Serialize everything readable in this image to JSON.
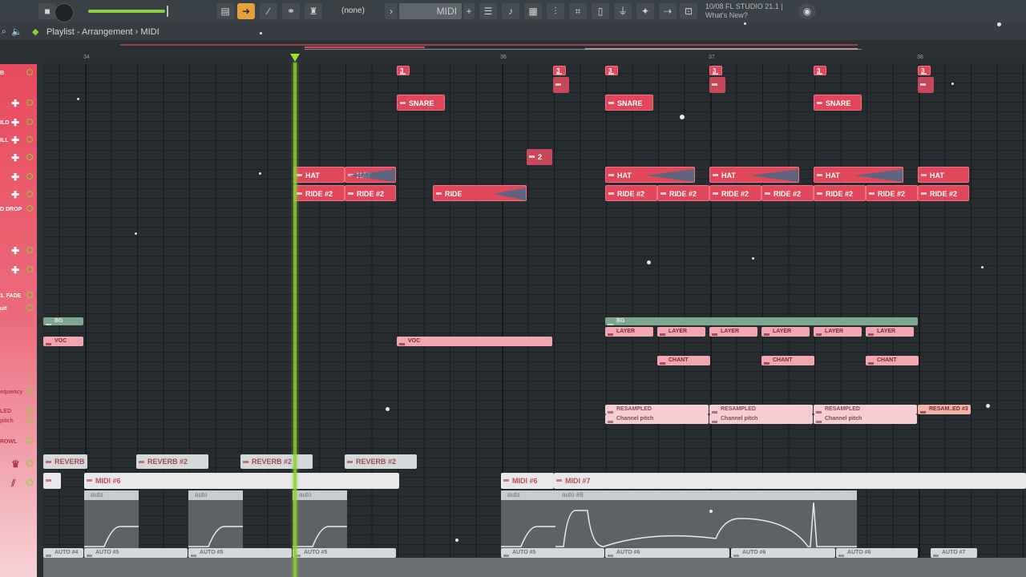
{
  "app": {
    "toolbar": {
      "pattern_selector": "(none)",
      "midi_field": "MIDI",
      "version_line1": "10/08  FL STUDIO 21.1 |",
      "version_line2": "What's New?"
    },
    "playlist": {
      "title": "Playlist - Arrangement",
      "breadcrumb_sep": "›",
      "breadcrumb_item": "MIDI"
    },
    "ruler": {
      "bars": [
        "34",
        "36",
        "37",
        "38"
      ]
    },
    "tracks": [
      {
        "label": "B",
        "color": "#e84a5f"
      },
      {
        "label": "",
        "color": "#e84a5f"
      },
      {
        "label": "ILD",
        "color": "#e84a5f"
      },
      {
        "label": "ILL",
        "color": "#e84a5f"
      },
      {
        "label": "",
        "color": "#e84a5f"
      },
      {
        "label": "",
        "color": "#e84a5f"
      },
      {
        "label": "",
        "color": "#e84a5f"
      },
      {
        "label": "D DROP",
        "color": "#e84a5f"
      },
      {
        "label": "1. FADE",
        "color": "#ec6c7c"
      },
      {
        "label": "uit",
        "color": "#ec6c7c"
      },
      {
        "label": "equency",
        "color": "#f2a9b2"
      },
      {
        "label": "LED",
        "color": "#f2a9b2"
      },
      {
        "label": "pitch",
        "color": "#f2a9b2"
      },
      {
        "label": "ROWL",
        "color": "#f2a9b2"
      }
    ],
    "clips": {
      "marker": "3",
      "snare": "SNARE",
      "hat": "HAT",
      "ride": "RIDE",
      "ride2": "RIDE #2",
      "small": "2",
      "bg": "BG",
      "voc": "VOC",
      "layer": "LAYER",
      "chant": "CHANT",
      "resampled": "RESAMPLED",
      "resampled3": "RESAM..ED #3",
      "channel_pitch": "Channel pitch",
      "reverb": "REVERB",
      "reverb2": "REVERB #2",
      "midi6": "MIDI #6",
      "midi7": "MIDI #7",
      "auto": "auto",
      "auto6": "auto #6",
      "auto4": "AUTO #4",
      "auto5": "AUTO #5",
      "auto6b": "AUTO #6",
      "auto7": "AUTO #7"
    }
  }
}
